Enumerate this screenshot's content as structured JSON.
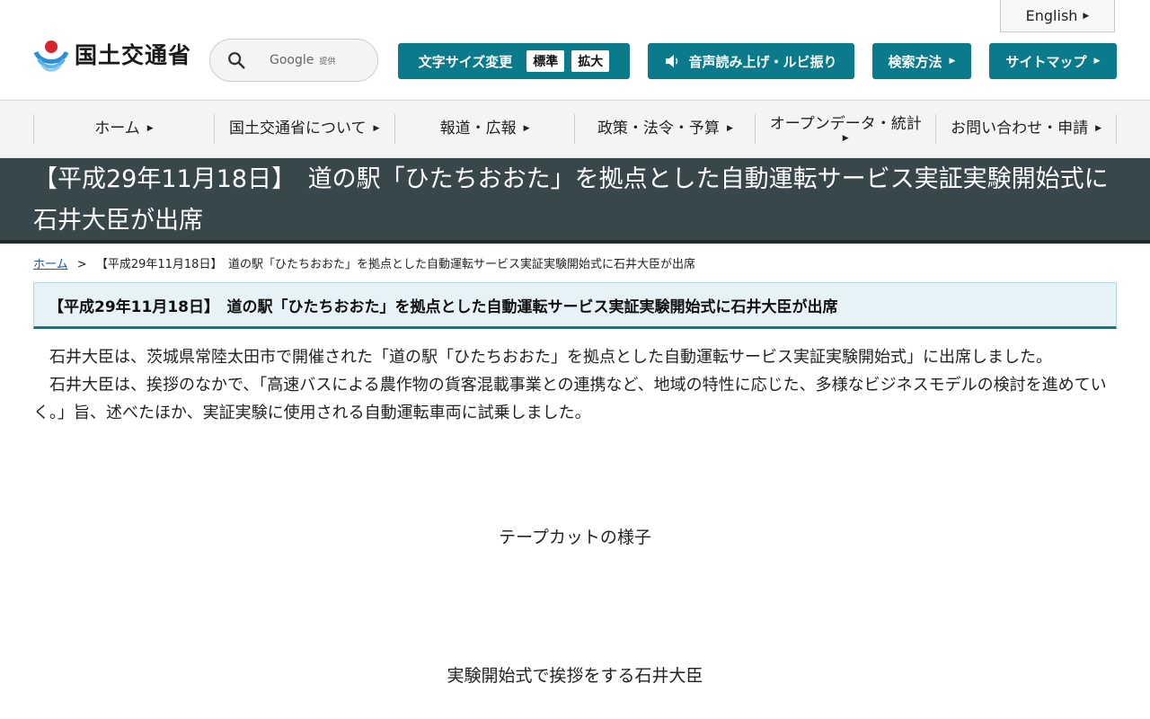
{
  "header": {
    "english_label": "English",
    "logo_text": "国土交通省",
    "search": {
      "google_label": "Google",
      "google_sub": "提供"
    },
    "font_size": {
      "label": "文字サイズ変更",
      "standard": "標準",
      "large": "拡大"
    },
    "voice_label": "音声読み上げ・ルビ振り",
    "search_method_label": "検索方法",
    "sitemap_label": "サイトマップ"
  },
  "nav": {
    "items": [
      {
        "label": "ホーム"
      },
      {
        "label": "国土交通省について"
      },
      {
        "label": "報道・広報"
      },
      {
        "label": "政策・法令・予算"
      },
      {
        "label": "オープンデータ・統計"
      },
      {
        "label": "お問い合わせ・申請"
      }
    ]
  },
  "page": {
    "title": "【平成29年11月18日】　道の駅「ひたちおおた」を拠点とした自動運転サービス実証実験開始式に石井大臣が出席",
    "breadcrumb": {
      "home": "ホーム",
      "separator": ">",
      "current": "【平成29年11月18日】　道の駅「ひたちおおた」を拠点とした自動運転サービス実証実験開始式に石井大臣が出席"
    },
    "section_heading": "【平成29年11月18日】　道の駅「ひたちおおた」を拠点とした自動運転サービス実証実験開始式に石井大臣が出席",
    "paragraphs": [
      "石井大臣は、茨城県常陸太田市で開催された「道の駅「ひたちおおた」を拠点とした自動運転サービス実証実験開始式」に出席しました。",
      "石井大臣は、挨拶のなかで、「高速バスによる農作物の貨客混載事業との連携など、地域の特性に応じた、多様なビジネスモデルの検討を進めていく。」旨、述べたほか、実証実験に使用される自動運転車両に試乗しました。"
    ],
    "captions": [
      "テープカットの様子",
      "実験開始式で挨拶をする石井大臣"
    ]
  },
  "colors": {
    "teal": "#0b7b8b",
    "title_band": "#37474b"
  }
}
